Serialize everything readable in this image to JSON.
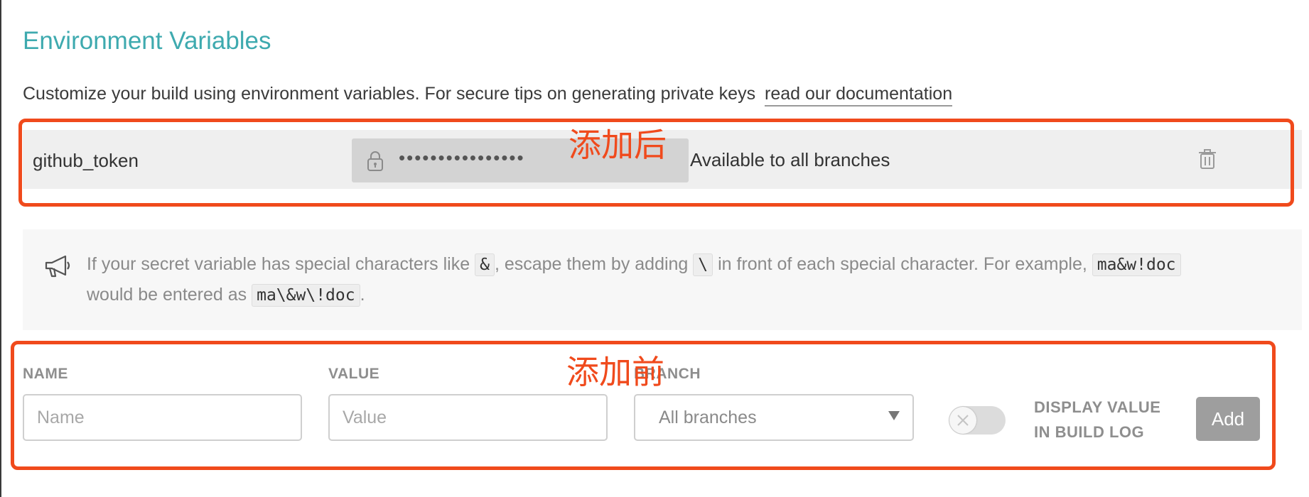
{
  "section": {
    "title": "Environment Variables",
    "description": "Customize your build using environment variables. For secure tips on generating private keys",
    "doc_link": "read our documentation"
  },
  "variable": {
    "name": "github_token",
    "masked_value": "••••••••••••••••",
    "scope": "Available to all branches",
    "icons": {
      "lock": "lock-icon",
      "delete": "trash-icon"
    }
  },
  "notice": {
    "icon": "megaphone-icon",
    "text1": "If your secret variable has special characters like ",
    "code1": "&",
    "text2": ", escape them by adding ",
    "code2": "\\",
    "text3": " in front of each special character. For example, ",
    "code3": "ma&w!doc",
    "text4": "would be entered as ",
    "code4": "ma\\&w\\!doc",
    "text5": "."
  },
  "form": {
    "name_label": "NAME",
    "name_placeholder": "Name",
    "value_label": "VALUE",
    "value_placeholder": "Value",
    "branch_label": "BRANCH",
    "branch_selected": "All branches",
    "display_toggle_on": false,
    "display_label_line1": "DISPLAY VALUE",
    "display_label_line2": "IN BUILD LOG",
    "add_label": "Add"
  },
  "annotations": {
    "after": "添加后",
    "before": "添加前",
    "color": "#f04a1c"
  },
  "colors": {
    "title": "#3eaaaf",
    "row_bg": "#efefef",
    "add_button_bg": "#9e9e9e"
  }
}
